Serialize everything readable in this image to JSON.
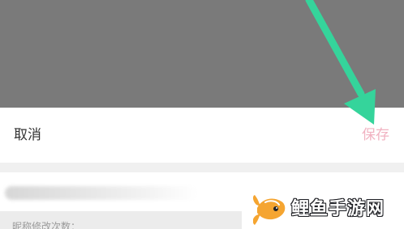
{
  "action_bar": {
    "cancel_label": "取消",
    "save_label": "保存"
  },
  "content": {
    "name_placeholder_state": "blurred",
    "info_text": "昵称修改次数："
  },
  "colors": {
    "overlay": "#7a7a7a",
    "save_disabled": "#f1b2c1",
    "annotation_arrow": "#35d49b"
  },
  "watermark": {
    "text": "鲤鱼手游网"
  }
}
